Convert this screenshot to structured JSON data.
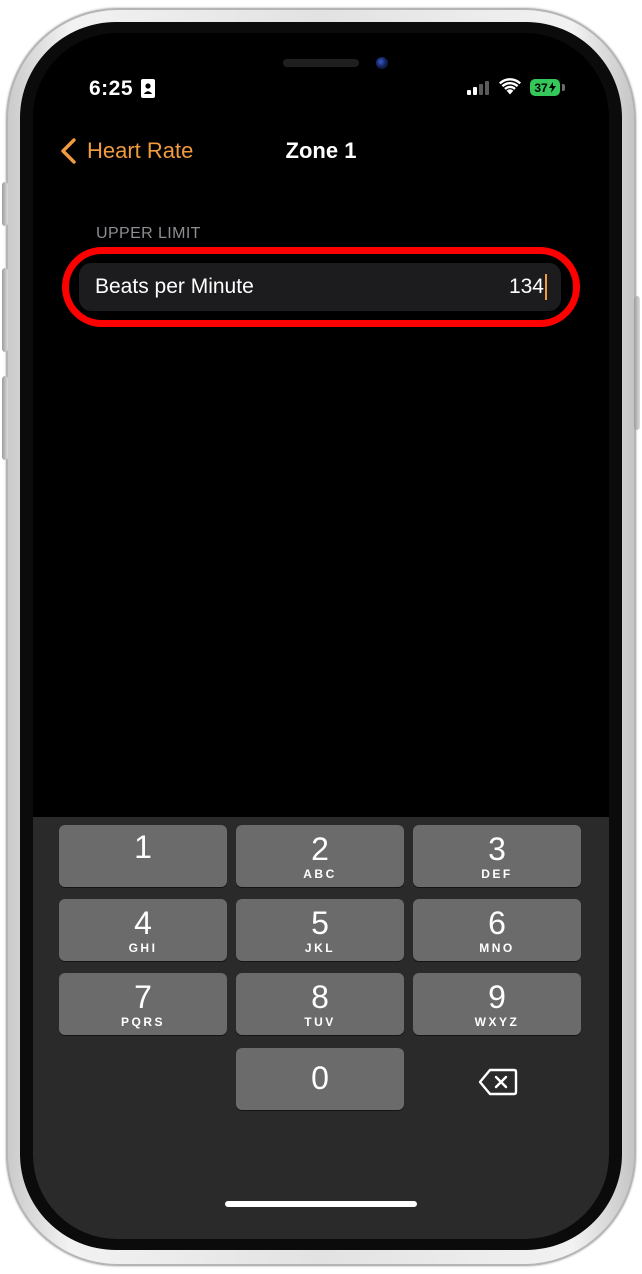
{
  "status_bar": {
    "time": "6:25",
    "battery": "37",
    "icons": [
      "id-card-icon",
      "cellular-signal-icon",
      "wifi-icon",
      "battery-charging-icon"
    ]
  },
  "nav": {
    "back_label": "Heart Rate",
    "title": "Zone 1"
  },
  "section": {
    "header": "UPPER LIMIT"
  },
  "field": {
    "label": "Beats per Minute",
    "value": "134"
  },
  "keypad": {
    "keys": [
      {
        "digit": "1",
        "letters": ""
      },
      {
        "digit": "2",
        "letters": "ABC"
      },
      {
        "digit": "3",
        "letters": "DEF"
      },
      {
        "digit": "4",
        "letters": "GHI"
      },
      {
        "digit": "5",
        "letters": "JKL"
      },
      {
        "digit": "6",
        "letters": "MNO"
      },
      {
        "digit": "7",
        "letters": "PQRS"
      },
      {
        "digit": "8",
        "letters": "TUV"
      },
      {
        "digit": "9",
        "letters": "WXYZ"
      },
      {
        "digit": "0",
        "letters": ""
      }
    ],
    "delete_icon": "backspace-icon"
  },
  "colors": {
    "accent": "#f19a3e",
    "highlight": "#ff0000",
    "battery": "#34c759"
  }
}
